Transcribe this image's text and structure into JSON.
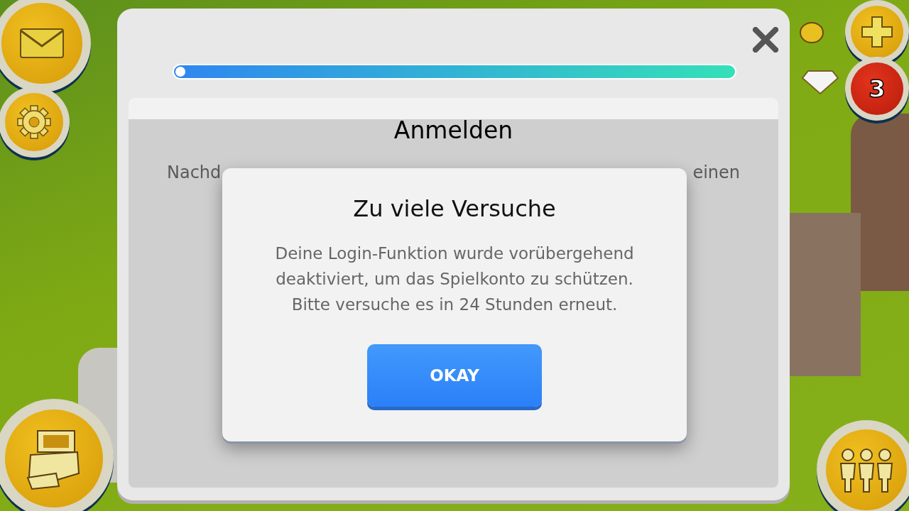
{
  "hud": {
    "notification_count": "3"
  },
  "panel": {
    "progress": {
      "level": 0.0
    },
    "card": {
      "title": "Anmelden",
      "text_left": "Nachd",
      "text_right": "einen"
    }
  },
  "dialog": {
    "title": "Zu viele Versuche",
    "message_lines": [
      "Deine Login-Funktion wurde vorübergehend",
      "deaktiviert, um das Spielkonto zu schützen.",
      "Bitte versuche es in 24 Stunden erneut."
    ],
    "button": "OKAY"
  }
}
